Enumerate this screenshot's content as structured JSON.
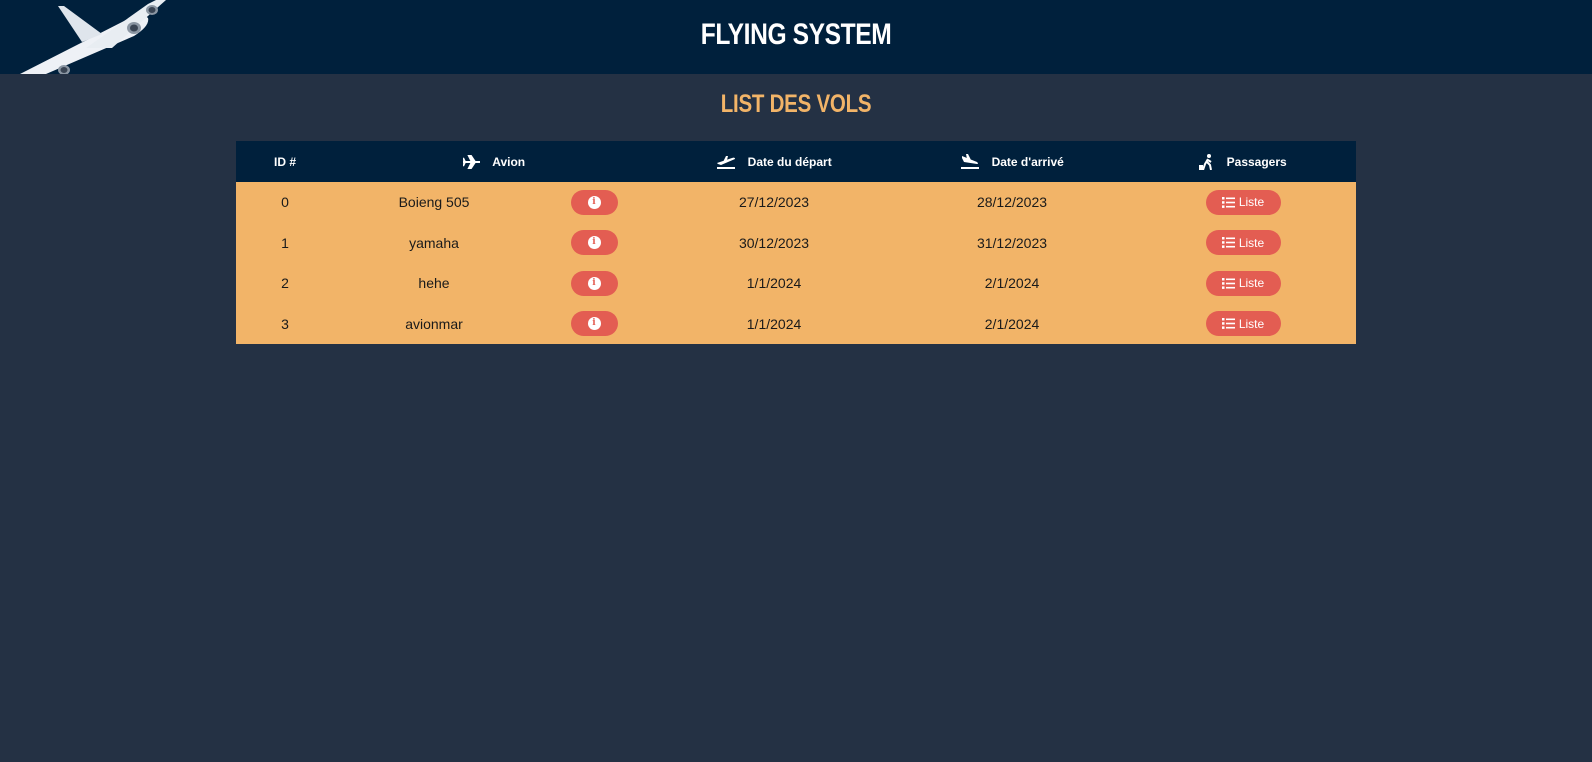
{
  "header": {
    "app_title": "FLYING SYSTEM"
  },
  "page": {
    "title": "LIST DES VOLS"
  },
  "table": {
    "columns": {
      "id": "ID #",
      "avion": "Avion",
      "depart": "Date du départ",
      "arrive": "Date d'arrivé",
      "passagers": "Passagers"
    },
    "list_button_label": "Liste",
    "info_icon_glyph": "i",
    "rows": [
      {
        "id": "0",
        "avion": "Boieng 505",
        "depart": "27/12/2023",
        "arrive": "28/12/2023"
      },
      {
        "id": "1",
        "avion": "yamaha",
        "depart": "30/12/2023",
        "arrive": "31/12/2023"
      },
      {
        "id": "2",
        "avion": "hehe",
        "depart": "1/1/2024",
        "arrive": "2/1/2024"
      },
      {
        "id": "3",
        "avion": "avionmar",
        "depart": "1/1/2024",
        "arrive": "2/1/2024"
      }
    ]
  },
  "icons": {
    "logo": "airplane-logo-icon",
    "avion": "plane-icon",
    "depart": "plane-departure-icon",
    "arrive": "plane-arrival-icon",
    "passagers": "person-luggage-icon",
    "info": "info-circle-icon",
    "list": "list-icon"
  },
  "colors": {
    "header_bg": "#00203c",
    "page_bg": "#243144",
    "accent": "#f2b468",
    "button": "#e35d52"
  }
}
